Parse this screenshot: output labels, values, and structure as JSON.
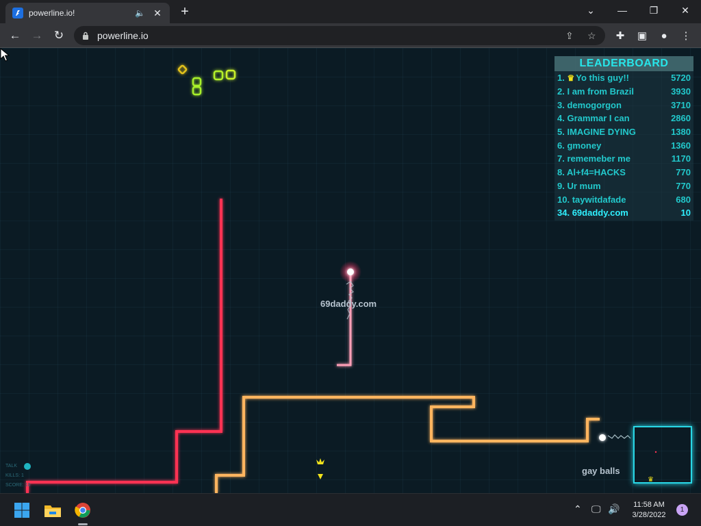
{
  "browser": {
    "tab_title": "powerline.io!",
    "url": "powerline.io",
    "close_glyph": "✕",
    "new_tab_glyph": "+",
    "audio_glyph": "🔈",
    "minimize_glyph": "—",
    "restore_glyph": "❐",
    "window_close_glyph": "✕",
    "chevron_glyph": "⌄",
    "back_glyph": "←",
    "forward_glyph": "→",
    "reload_glyph": "↻",
    "share_glyph": "⇪",
    "star_glyph": "☆",
    "extensions_glyph": "✚",
    "sidepanel_glyph": "▣",
    "profile_glyph": "●",
    "menu_glyph": "⋮"
  },
  "leaderboard": {
    "title": "LEADERBOARD",
    "crown_glyph": "♛",
    "entries": [
      {
        "rank": "1.",
        "name": "Yo this guy!!",
        "score": "5720"
      },
      {
        "rank": "2.",
        "name": "I am from Brazil",
        "score": "3930"
      },
      {
        "rank": "3.",
        "name": "demogorgon",
        "score": "3710"
      },
      {
        "rank": "4.",
        "name": "Grammar I can",
        "score": "2860"
      },
      {
        "rank": "5.",
        "name": "IMAGINE DYING",
        "score": "1380"
      },
      {
        "rank": "6.",
        "name": "gmoney",
        "score": "1360"
      },
      {
        "rank": "7.",
        "name": "rememeber me",
        "score": "1170"
      },
      {
        "rank": "8.",
        "name": "Al+f4=HACKS",
        "score": "770"
      },
      {
        "rank": "9.",
        "name": "Ur mum",
        "score": "770"
      },
      {
        "rank": "10.",
        "name": "taywitdafade",
        "score": "680"
      }
    ],
    "self": {
      "rank": "34.",
      "name": "69daddy.com",
      "score": "10"
    }
  },
  "game": {
    "player_name": "69daddy.com",
    "enemy_name": "gay balls",
    "stats": {
      "talk": "TALK",
      "kills": "KILLS: 1",
      "score": "SCORE: 10"
    },
    "colors": {
      "player": "#ff9fb7",
      "red_line": "#ff3352",
      "orange_line": "#ffb55e",
      "minimap": "#29d7e6",
      "food": "#9ff02a"
    }
  },
  "taskbar": {
    "time": "11:58 AM",
    "date": "3/28/2022",
    "notifications": "1",
    "tray_chevron": "⌃",
    "tray_monitor": "🖵",
    "tray_volume": "🔊"
  }
}
